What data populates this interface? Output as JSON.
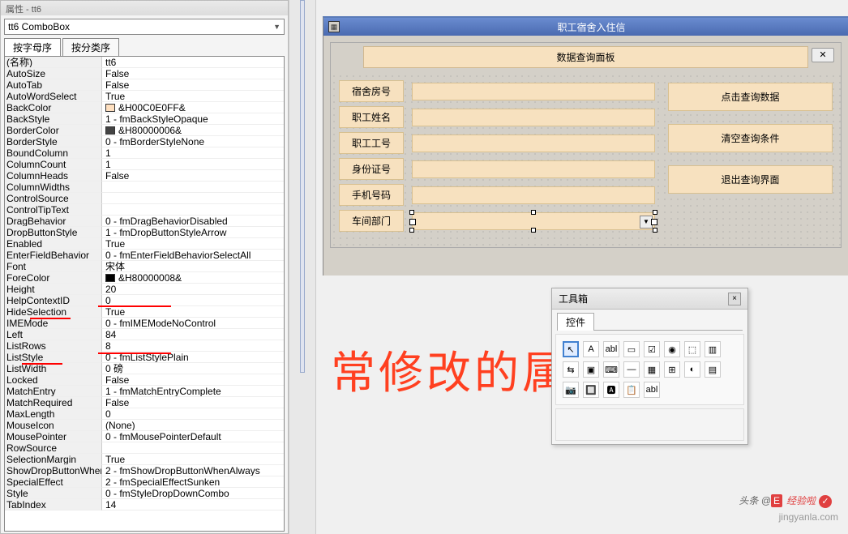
{
  "prop_panel": {
    "title": "属性 - tt6",
    "selector": "tt6 ComboBox",
    "tabs": {
      "alpha": "按字母序",
      "category": "按分类序"
    }
  },
  "props": [
    {
      "n": "(名称)",
      "v": "tt6"
    },
    {
      "n": "AutoSize",
      "v": "False"
    },
    {
      "n": "AutoTab",
      "v": "False"
    },
    {
      "n": "AutoWordSelect",
      "v": "True"
    },
    {
      "n": "BackColor",
      "v": "&H00C0E0FF&",
      "sw": "#ffe0c0"
    },
    {
      "n": "BackStyle",
      "v": "1 - fmBackStyleOpaque"
    },
    {
      "n": "BorderColor",
      "v": "&H80000006&",
      "sw": "#444444"
    },
    {
      "n": "BorderStyle",
      "v": "0 - fmBorderStyleNone"
    },
    {
      "n": "BoundColumn",
      "v": "1"
    },
    {
      "n": "ColumnCount",
      "v": "1"
    },
    {
      "n": "ColumnHeads",
      "v": "False"
    },
    {
      "n": "ColumnWidths",
      "v": ""
    },
    {
      "n": "ControlSource",
      "v": ""
    },
    {
      "n": "ControlTipText",
      "v": ""
    },
    {
      "n": "DragBehavior",
      "v": "0 - fmDragBehaviorDisabled"
    },
    {
      "n": "DropButtonStyle",
      "v": "1 - fmDropButtonStyleArrow"
    },
    {
      "n": "Enabled",
      "v": "True"
    },
    {
      "n": "EnterFieldBehavior",
      "v": "0 - fmEnterFieldBehaviorSelectAll"
    },
    {
      "n": "Font",
      "v": "宋体"
    },
    {
      "n": "ForeColor",
      "v": "&H80000008&",
      "sw": "#000000"
    },
    {
      "n": "Height",
      "v": "20"
    },
    {
      "n": "HelpContextID",
      "v": "0"
    },
    {
      "n": "HideSelection",
      "v": "True"
    },
    {
      "n": "IMEMode",
      "v": "0 - fmIMEModeNoControl"
    },
    {
      "n": "Left",
      "v": "84"
    },
    {
      "n": "ListRows",
      "v": "8"
    },
    {
      "n": "ListStyle",
      "v": "0 - fmListStylePlain"
    },
    {
      "n": "ListWidth",
      "v": "0 磅"
    },
    {
      "n": "Locked",
      "v": "False"
    },
    {
      "n": "MatchEntry",
      "v": "1 - fmMatchEntryComplete"
    },
    {
      "n": "MatchRequired",
      "v": "False"
    },
    {
      "n": "MaxLength",
      "v": "0"
    },
    {
      "n": "MouseIcon",
      "v": "(None)"
    },
    {
      "n": "MousePointer",
      "v": "0 - fmMousePointerDefault"
    },
    {
      "n": "RowSource",
      "v": ""
    },
    {
      "n": "SelectionMargin",
      "v": "True"
    },
    {
      "n": "ShowDropButtonWhen",
      "v": "2 - fmShowDropButtonWhenAlways"
    },
    {
      "n": "SpecialEffect",
      "v": "2 - fmSpecialEffectSunken"
    },
    {
      "n": "Style",
      "v": "0 - fmStyleDropDownCombo"
    },
    {
      "n": "TabIndex",
      "v": "14"
    }
  ],
  "form": {
    "title": "职工宿舍入住信",
    "frame_title": "数据查询面板",
    "close": "✕",
    "fields": {
      "room": "宿舍房号",
      "name": "职工姓名",
      "empno": "职工工号",
      "idno": "身份证号",
      "phone": "手机号码",
      "dept": "车间部门"
    },
    "buttons": {
      "query": "点击查询数据",
      "clear": "清空查询条件",
      "exit": "退出查询界面"
    }
  },
  "toolbox": {
    "title": "工具箱",
    "tab": "控件",
    "tools": [
      "↖",
      "A",
      "abl",
      "▭",
      "☑",
      "◉",
      "⬚",
      "▥",
      "⇆",
      "▣",
      "⌨",
      "—",
      "▦",
      "⊞",
      "◐",
      "▤",
      "📷",
      "🔲",
      "🅰",
      "📋",
      "abl"
    ]
  },
  "annotation": "常修改的属性",
  "watermark": {
    "l1a": "头条 @",
    "l1b": "E",
    "l1c": "经验啦",
    "l2": "jingyanla.com"
  }
}
